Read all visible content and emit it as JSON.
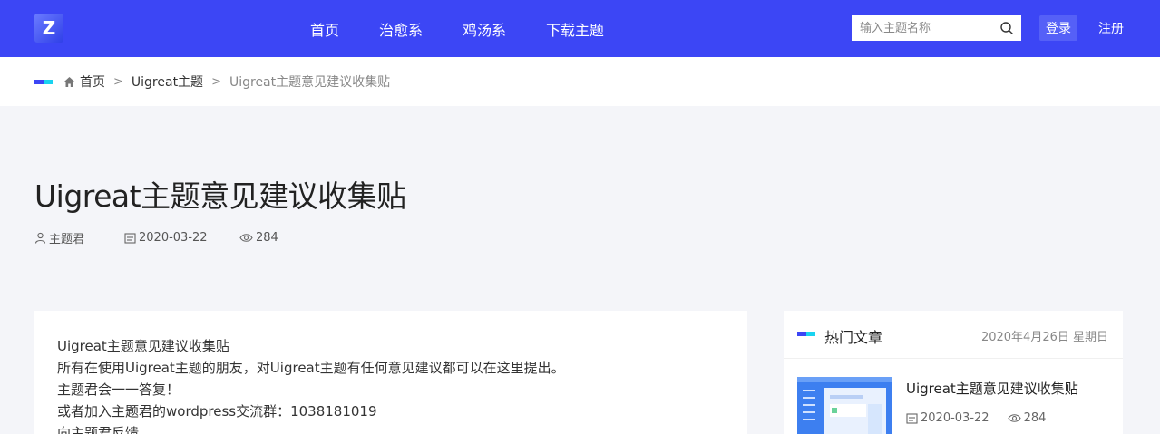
{
  "header": {
    "logo_letter": "Z",
    "nav": [
      "首页",
      "治愈系",
      "鸡汤系",
      "下载主题"
    ],
    "search_placeholder": "输入主题名称",
    "login_label": "登录",
    "register_label": "注册"
  },
  "breadcrumb": {
    "home": "首页",
    "category": "Uigreat主题",
    "current": "Uigreat主题意见建议收集贴"
  },
  "post": {
    "title": "Uigreat主题意见建议收集贴",
    "author": "主题君",
    "date": "2020-03-22",
    "views": "284"
  },
  "content": {
    "line1_link": "Uigreat主题",
    "line1_rest": "意见建议收集贴",
    "line2": "所有在使用Uigreat主题的朋友，对Uigreat主题有任何意见建议都可以在这里提出。",
    "line3": "主题君会一一答复！",
    "line4": "或者加入主题君的wordpress交流群：1038181019",
    "line5": "向主题君反馈"
  },
  "sidebar": {
    "title": "热门文章",
    "date": "2020年4月26日 星期日",
    "post_title": "Uigreat主题意见建议收集贴",
    "post_date": "2020-03-22",
    "post_views": "284"
  },
  "colors": {
    "header_bg": "#3c46f5",
    "accent_blue": "#3c46f5",
    "accent_cyan": "#19d3f0"
  }
}
